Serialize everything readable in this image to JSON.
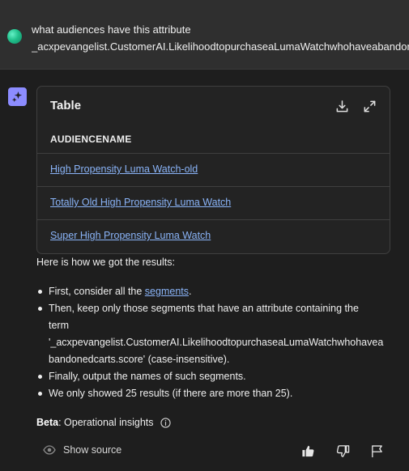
{
  "query": {
    "line1": "what audiences have this attribute",
    "line2": "_acxpevangelist.CustomerAI.LikelihoodtopurchaseaLumaWatchwhohaveabandonedcarts.score"
  },
  "table": {
    "title": "Table",
    "column": "AUDIENCENAME",
    "rows": [
      "High Propensity Luma Watch-old",
      "Totally Old High Propensity Luma Watch",
      "Super High Propensity Luma Watch"
    ]
  },
  "explanation": {
    "heading": "Here is how we got the results:",
    "b1_prefix": "First, consider all the ",
    "b1_link": "segments",
    "b1_suffix": ".",
    "b2_line1": "Then, keep only those segments that have an attribute containing the",
    "b2_line2": "term",
    "b2_line3": "'_acxpevangelist.CustomerAI.LikelihoodtopurchaseaLumaWatchwhohavea",
    "b2_line4": "bandonedcarts.score' (case-insensitive).",
    "b3": "Finally, output the names of such segments.",
    "b4": "We only showed 25 results (if there are more than 25)."
  },
  "beta": {
    "label": "Beta",
    "text": ": Operational insights"
  },
  "footer": {
    "show_source": "Show source"
  },
  "colors": {
    "background": "#1e1e1e",
    "query_bg": "#2f2f2f",
    "link": "#8ab4f8",
    "ai_badge": "#8c8cff"
  },
  "icons": [
    "user-avatar-icon",
    "ai-sparkle-icon",
    "download-icon",
    "expand-icon",
    "info-icon",
    "eye-icon",
    "thumbs-up-icon",
    "thumbs-down-icon",
    "flag-icon"
  ]
}
